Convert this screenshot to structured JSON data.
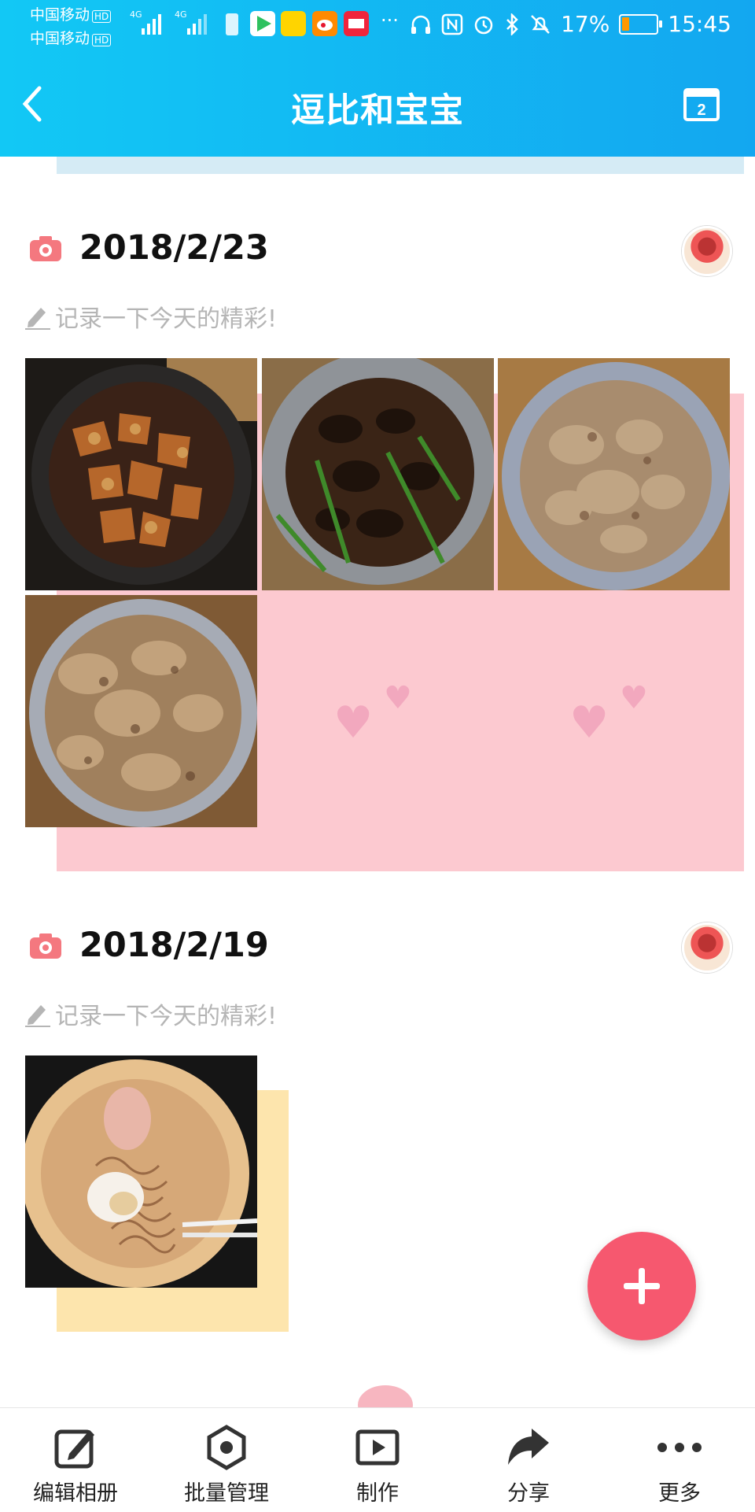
{
  "status_bar": {
    "carrier1": "中国移动",
    "carrier2": "中国移动",
    "hd": "HD",
    "network": "4G",
    "notif_more": "···",
    "battery": "17%",
    "time": "15:45"
  },
  "header": {
    "title": "逗比和宝宝",
    "calendar_icon_number": "2"
  },
  "entries": [
    {
      "date": "2018/2/23",
      "note_placeholder": "记录一下今天的精彩!",
      "photo_count": 4
    },
    {
      "date": "2018/2/19",
      "note_placeholder": "记录一下今天的精彩!",
      "photo_count": 1
    }
  ],
  "bottom_bar": {
    "items": [
      {
        "label": "编辑相册",
        "icon": "edit-icon"
      },
      {
        "label": "批量管理",
        "icon": "batch-manage-icon"
      },
      {
        "label": "制作",
        "icon": "play-icon"
      },
      {
        "label": "分享",
        "icon": "share-icon"
      },
      {
        "label": "更多",
        "icon": "more-icon"
      }
    ]
  },
  "colors": {
    "header_start": "#12c8f5",
    "header_end": "#13a7f0",
    "accent_pink": "#f6586f",
    "pink_bg": "#fcc9d0",
    "yellow_bg": "#fde5ad"
  }
}
